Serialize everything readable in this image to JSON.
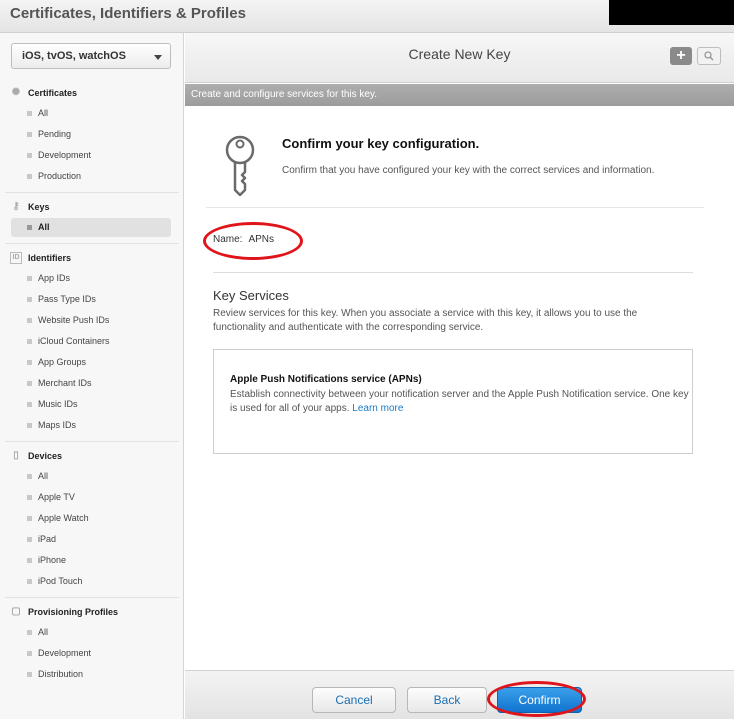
{
  "app": {
    "title": "Certificates, Identifiers & Profiles"
  },
  "sidebar": {
    "platform_select": "iOS, tvOS, watchOS",
    "sections": [
      {
        "label": "Certificates",
        "icon": "certificate-icon",
        "items": [
          "All",
          "Pending",
          "Development",
          "Production"
        ]
      },
      {
        "label": "Keys",
        "icon": "key-icon",
        "items": [
          "All"
        ],
        "active_item": "All"
      },
      {
        "label": "Identifiers",
        "icon": "id-icon",
        "items": [
          "App IDs",
          "Pass Type IDs",
          "Website Push IDs",
          "iCloud Containers",
          "App Groups",
          "Merchant IDs",
          "Music IDs",
          "Maps IDs"
        ]
      },
      {
        "label": "Devices",
        "icon": "device-icon",
        "items": [
          "All",
          "Apple TV",
          "Apple Watch",
          "iPad",
          "iPhone",
          "iPod Touch"
        ]
      },
      {
        "label": "Provisioning Profiles",
        "icon": "document-icon",
        "items": [
          "All",
          "Development",
          "Distribution"
        ]
      }
    ]
  },
  "main": {
    "title": "Create New Key",
    "add_button": "+",
    "subtitle": "Create and configure services for this key.",
    "confirm_title": "Confirm your key configuration.",
    "confirm_desc": "Confirm that you have configured your key with the correct services and information.",
    "name_label": "Name:",
    "name_value": "APNs",
    "key_services_title": "Key Services",
    "key_services_desc": "Review services for this key. When you associate a service with this key, it allows you to use the functionality and authenticate with the corresponding service.",
    "service": {
      "title": "Apple Push Notifications service (APNs)",
      "desc": "Establish connectivity between your notification server and the Apple Push Notification service. One key is used for all of your apps.",
      "link": "Learn more"
    }
  },
  "footer": {
    "cancel": "Cancel",
    "back": "Back",
    "confirm": "Confirm"
  },
  "colors": {
    "accent": "#1a79c4",
    "annotation": "#e0141b",
    "confirm_button": "#1173cf"
  }
}
